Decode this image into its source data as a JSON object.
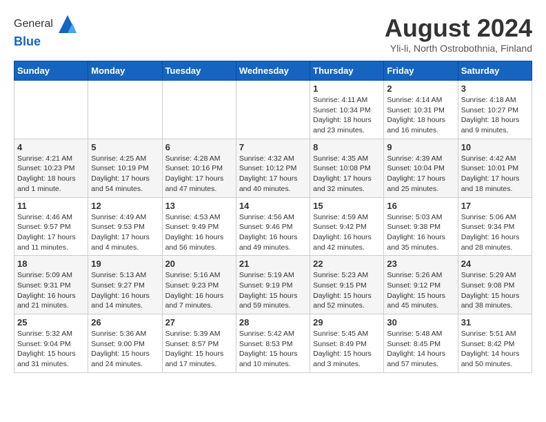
{
  "header": {
    "logo_general": "General",
    "logo_blue": "Blue",
    "month_title": "August 2024",
    "subtitle": "Yli-li, North Ostrobothnia, Finland"
  },
  "weekdays": [
    "Sunday",
    "Monday",
    "Tuesday",
    "Wednesday",
    "Thursday",
    "Friday",
    "Saturday"
  ],
  "weeks": [
    [
      {
        "day": "",
        "info": ""
      },
      {
        "day": "",
        "info": ""
      },
      {
        "day": "",
        "info": ""
      },
      {
        "day": "",
        "info": ""
      },
      {
        "day": "1",
        "info": "Sunrise: 4:11 AM\nSunset: 10:34 PM\nDaylight: 18 hours\nand 23 minutes."
      },
      {
        "day": "2",
        "info": "Sunrise: 4:14 AM\nSunset: 10:31 PM\nDaylight: 18 hours\nand 16 minutes."
      },
      {
        "day": "3",
        "info": "Sunrise: 4:18 AM\nSunset: 10:27 PM\nDaylight: 18 hours\nand 9 minutes."
      }
    ],
    [
      {
        "day": "4",
        "info": "Sunrise: 4:21 AM\nSunset: 10:23 PM\nDaylight: 18 hours\nand 1 minute."
      },
      {
        "day": "5",
        "info": "Sunrise: 4:25 AM\nSunset: 10:19 PM\nDaylight: 17 hours\nand 54 minutes."
      },
      {
        "day": "6",
        "info": "Sunrise: 4:28 AM\nSunset: 10:16 PM\nDaylight: 17 hours\nand 47 minutes."
      },
      {
        "day": "7",
        "info": "Sunrise: 4:32 AM\nSunset: 10:12 PM\nDaylight: 17 hours\nand 40 minutes."
      },
      {
        "day": "8",
        "info": "Sunrise: 4:35 AM\nSunset: 10:08 PM\nDaylight: 17 hours\nand 32 minutes."
      },
      {
        "day": "9",
        "info": "Sunrise: 4:39 AM\nSunset: 10:04 PM\nDaylight: 17 hours\nand 25 minutes."
      },
      {
        "day": "10",
        "info": "Sunrise: 4:42 AM\nSunset: 10:01 PM\nDaylight: 17 hours\nand 18 minutes."
      }
    ],
    [
      {
        "day": "11",
        "info": "Sunrise: 4:46 AM\nSunset: 9:57 PM\nDaylight: 17 hours\nand 11 minutes."
      },
      {
        "day": "12",
        "info": "Sunrise: 4:49 AM\nSunset: 9:53 PM\nDaylight: 17 hours\nand 4 minutes."
      },
      {
        "day": "13",
        "info": "Sunrise: 4:53 AM\nSunset: 9:49 PM\nDaylight: 16 hours\nand 56 minutes."
      },
      {
        "day": "14",
        "info": "Sunrise: 4:56 AM\nSunset: 9:46 PM\nDaylight: 16 hours\nand 49 minutes."
      },
      {
        "day": "15",
        "info": "Sunrise: 4:59 AM\nSunset: 9:42 PM\nDaylight: 16 hours\nand 42 minutes."
      },
      {
        "day": "16",
        "info": "Sunrise: 5:03 AM\nSunset: 9:38 PM\nDaylight: 16 hours\nand 35 minutes."
      },
      {
        "day": "17",
        "info": "Sunrise: 5:06 AM\nSunset: 9:34 PM\nDaylight: 16 hours\nand 28 minutes."
      }
    ],
    [
      {
        "day": "18",
        "info": "Sunrise: 5:09 AM\nSunset: 9:31 PM\nDaylight: 16 hours\nand 21 minutes."
      },
      {
        "day": "19",
        "info": "Sunrise: 5:13 AM\nSunset: 9:27 PM\nDaylight: 16 hours\nand 14 minutes."
      },
      {
        "day": "20",
        "info": "Sunrise: 5:16 AM\nSunset: 9:23 PM\nDaylight: 16 hours\nand 7 minutes."
      },
      {
        "day": "21",
        "info": "Sunrise: 5:19 AM\nSunset: 9:19 PM\nDaylight: 15 hours\nand 59 minutes."
      },
      {
        "day": "22",
        "info": "Sunrise: 5:23 AM\nSunset: 9:15 PM\nDaylight: 15 hours\nand 52 minutes."
      },
      {
        "day": "23",
        "info": "Sunrise: 5:26 AM\nSunset: 9:12 PM\nDaylight: 15 hours\nand 45 minutes."
      },
      {
        "day": "24",
        "info": "Sunrise: 5:29 AM\nSunset: 9:08 PM\nDaylight: 15 hours\nand 38 minutes."
      }
    ],
    [
      {
        "day": "25",
        "info": "Sunrise: 5:32 AM\nSunset: 9:04 PM\nDaylight: 15 hours\nand 31 minutes."
      },
      {
        "day": "26",
        "info": "Sunrise: 5:36 AM\nSunset: 9:00 PM\nDaylight: 15 hours\nand 24 minutes."
      },
      {
        "day": "27",
        "info": "Sunrise: 5:39 AM\nSunset: 8:57 PM\nDaylight: 15 hours\nand 17 minutes."
      },
      {
        "day": "28",
        "info": "Sunrise: 5:42 AM\nSunset: 8:53 PM\nDaylight: 15 hours\nand 10 minutes."
      },
      {
        "day": "29",
        "info": "Sunrise: 5:45 AM\nSunset: 8:49 PM\nDaylight: 15 hours\nand 3 minutes."
      },
      {
        "day": "30",
        "info": "Sunrise: 5:48 AM\nSunset: 8:45 PM\nDaylight: 14 hours\nand 57 minutes."
      },
      {
        "day": "31",
        "info": "Sunrise: 5:51 AM\nSunset: 8:42 PM\nDaylight: 14 hours\nand 50 minutes."
      }
    ]
  ]
}
